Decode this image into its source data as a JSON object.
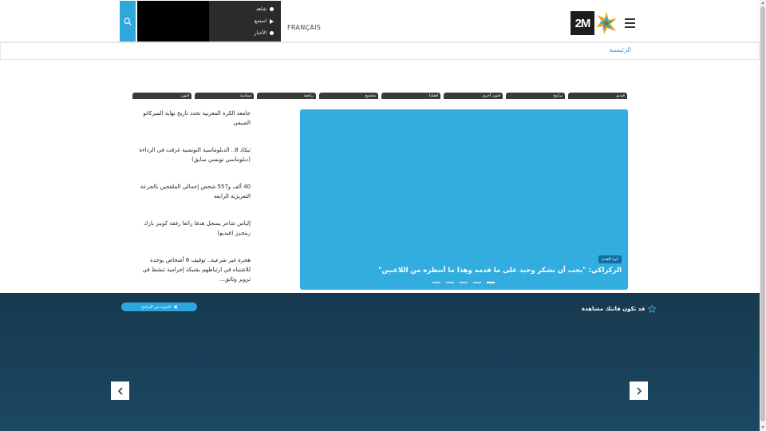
{
  "header": {
    "lang_label": "FRANÇAIS",
    "logo_text": "2M",
    "live_menu": [
      {
        "label": "شاهد",
        "icon": "circle-icon"
      },
      {
        "label": "استمع",
        "icon": "play-icon"
      },
      {
        "label": "الأخبار",
        "icon": "circle-icon"
      }
    ]
  },
  "breadcrumb": {
    "home": "الرئيسية"
  },
  "tabs": [
    {
      "label": "فنون"
    },
    {
      "label": "سياسة"
    },
    {
      "label": "رياضة"
    },
    {
      "label": "مجتمع"
    },
    {
      "label": "قضايا"
    },
    {
      "label": "فنون أخرى"
    },
    {
      "label": "برامج"
    },
    {
      "label": "فيديو"
    }
  ],
  "news": [
    {
      "title": "جامعة الكرة المغربية تحدد تاريخ نهاية الميركاتو الصيفي"
    },
    {
      "title": "تيكاد 8.. الدبلوماسية التونسية غرقت في الرداءة (دبلوماسي تونسي سابق)"
    },
    {
      "title": "40 ألف و557 شخص إجمالي الملقحين بالجرعة التعزيزية الرابعة"
    },
    {
      "title": "إلياس شاعر يسجل هدفا رائعا رفقة كوينز بارك رينجرز (فيديو)"
    },
    {
      "title": "هجرة غير شرعية.. توقيف 6 أشخاص يوجدة للاشتباه في ارتباطهم بشبكة إجرامية تنشط في تزوير وثائق..."
    }
  ],
  "hero": {
    "badge": "كرة القدم",
    "title": "الركراكي: \"يجب أن نشكر وحيد على ما قدمه وهذا ما أنتظره من اللاعبين\"",
    "slide_count": 5,
    "active_slide": 5
  },
  "programs": {
    "title": "قد تكون فاتتك مشاهدة",
    "more_label": "المزيد من البرامج"
  },
  "colors": {
    "accent": "#2ea7dc",
    "hero_bg": "#33addf",
    "programs_bg": "#17394f"
  }
}
